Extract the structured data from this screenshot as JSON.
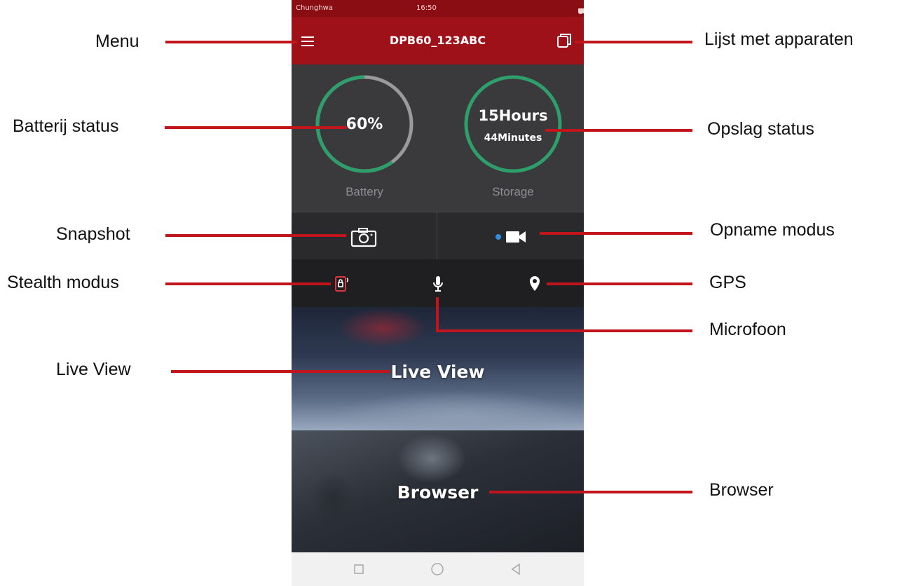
{
  "phone": {
    "status_bar": {
      "carrier": "Chunghwa",
      "time": "16:50",
      "battery": "100%"
    },
    "app_bar": {
      "title": "DPB60_123ABC"
    },
    "battery": {
      "value_text": "60%",
      "label": "Battery",
      "level": 0.6
    },
    "storage": {
      "hours_text": "15Hours",
      "minutes_text": "44Minutes",
      "label": "Storage"
    },
    "tiles": {
      "live_view": "Live View",
      "browser": "Browser"
    }
  },
  "annotations": {
    "menu": "Menu",
    "device_list": "Lijst met apparaten",
    "battery_status": "Batterij  status",
    "storage_status": "Opslag status",
    "snapshot": "Snapshot",
    "record_mode": "Opname modus",
    "stealth_mode": "Stealth  modus",
    "gps": "GPS",
    "microphone": "Microfoon",
    "live_view": "Live  View",
    "browser": "Browser"
  },
  "colors": {
    "app_bar": "#9e1119",
    "callout_line": "#c0151d",
    "gauge_ring": "#2e9e6a",
    "record_dot": "#2f8fe0"
  },
  "icons": [
    "menu-icon",
    "device-list-icon",
    "camera-icon",
    "record-dot-icon",
    "video-camera-icon",
    "stealth-icon",
    "microphone-icon",
    "location-pin-icon",
    "square-icon",
    "circle-icon",
    "back-triangle-icon"
  ]
}
